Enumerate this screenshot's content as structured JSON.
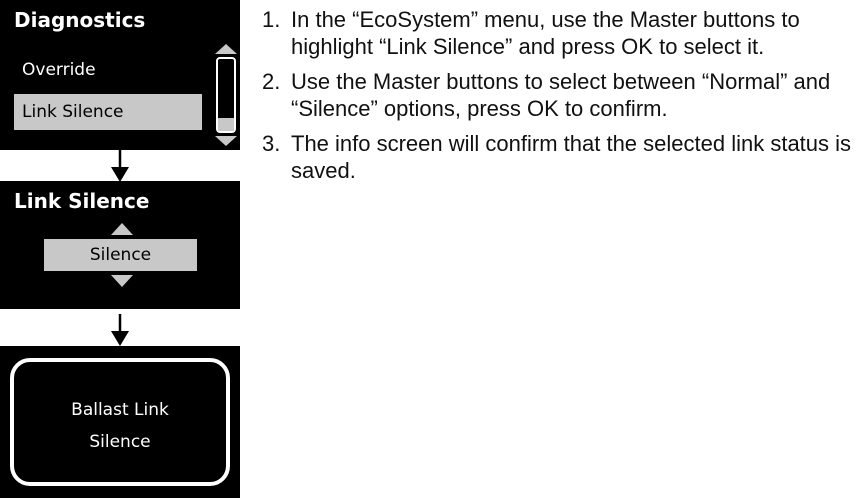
{
  "screen1": {
    "title": "Diagnostics",
    "items": [
      {
        "label": "Override"
      },
      {
        "label": "Link Silence",
        "selected": true
      }
    ]
  },
  "screen2": {
    "title": "Link Silence",
    "value": "Silence"
  },
  "screen3": {
    "line1": "Ballast Link",
    "line2": "Silence"
  },
  "steps": [
    {
      "number": "1.",
      "text": "In the “EcoSystem” menu, use the Master buttons to highlight “Link Silence” and press OK to select it."
    },
    {
      "number": "2.",
      "text": "Use the Master buttons to select between “Normal” and “Silence” options, press OK to confirm."
    },
    {
      "number": "3.",
      "text": "The info screen will confirm that the selected link status is saved."
    }
  ],
  "colors": {
    "screen_bg": "#000000",
    "selected_bg": "#c8c8c8",
    "text": "#111111"
  }
}
